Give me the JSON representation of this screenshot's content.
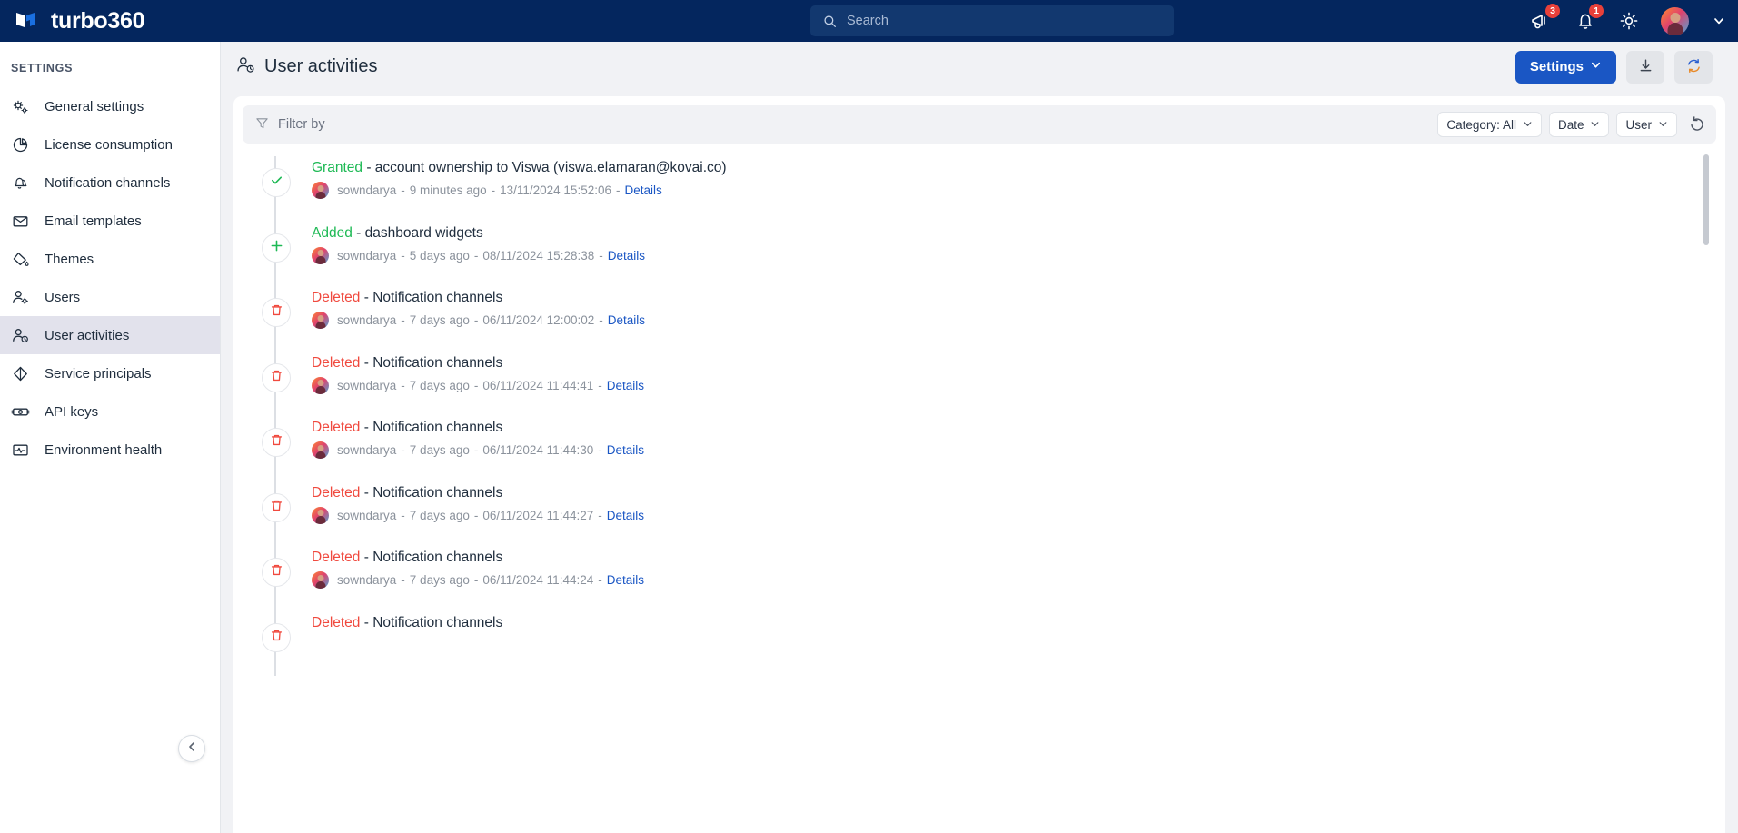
{
  "brand": {
    "name": "turbo360",
    "logo_icon": "turbo360-logo"
  },
  "search": {
    "placeholder": "Search",
    "icon": "search-icon"
  },
  "topbar": {
    "announcements": {
      "icon": "megaphone-icon",
      "badge": "3"
    },
    "notifications": {
      "icon": "bell-icon",
      "badge": "1"
    },
    "settings": {
      "icon": "gear-icon"
    },
    "account": {
      "icon": "user-avatar",
      "chevron": "chevron-down-icon"
    }
  },
  "sidebar": {
    "title": "SETTINGS",
    "collapse_icon": "chevron-left-icon",
    "items": [
      {
        "label": "General settings",
        "icon": "gears-icon",
        "active": false
      },
      {
        "label": "License consumption",
        "icon": "pie-chart-icon",
        "active": false
      },
      {
        "label": "Notification channels",
        "icon": "bells-icon",
        "active": false
      },
      {
        "label": "Email templates",
        "icon": "envelope-icon",
        "active": false
      },
      {
        "label": "Themes",
        "icon": "paint-bucket-icon",
        "active": false
      },
      {
        "label": "Users",
        "icon": "user-gear-icon",
        "active": false
      },
      {
        "label": "User activities",
        "icon": "user-clock-icon",
        "active": true
      },
      {
        "label": "Service principals",
        "icon": "diamond-icon",
        "active": false
      },
      {
        "label": "API keys",
        "icon": "key-card-icon",
        "active": false
      },
      {
        "label": "Environment health",
        "icon": "pulse-monitor-icon",
        "active": false
      }
    ]
  },
  "page": {
    "title": "User activities",
    "title_icon": "user-clock-icon",
    "settings_button": "Settings",
    "settings_chevron": "chevron-down-icon",
    "download_icon": "download-icon",
    "refresh_icon": "refresh-icon"
  },
  "filters": {
    "filter_by_label": "Filter by",
    "filter_icon": "funnel-icon",
    "category": {
      "label": "Category: All",
      "chevron": "chevron-down-icon"
    },
    "date": {
      "label": "Date",
      "chevron": "chevron-down-icon"
    },
    "user": {
      "label": "User",
      "chevron": "chevron-down-icon"
    },
    "reset_icon": "reset-icon"
  },
  "activities": [
    {
      "verb": "Granted",
      "verb_color": "green",
      "marker_icon": "check-icon",
      "description": "- account ownership to Viswa (viswa.elamaran@kovai.co)",
      "user": "sowndarya",
      "relative_time": "9 minutes ago",
      "timestamp": "13/11/2024 15:52:06",
      "details_label": "Details"
    },
    {
      "verb": "Added",
      "verb_color": "green",
      "marker_icon": "plus-icon",
      "description": "- dashboard widgets",
      "user": "sowndarya",
      "relative_time": "5 days ago",
      "timestamp": "08/11/2024 15:28:38",
      "details_label": "Details"
    },
    {
      "verb": "Deleted",
      "verb_color": "red",
      "marker_icon": "trash-icon",
      "description": "- Notification channels",
      "user": "sowndarya",
      "relative_time": "7 days ago",
      "timestamp": "06/11/2024 12:00:02",
      "details_label": "Details"
    },
    {
      "verb": "Deleted",
      "verb_color": "red",
      "marker_icon": "trash-icon",
      "description": "- Notification channels",
      "user": "sowndarya",
      "relative_time": "7 days ago",
      "timestamp": "06/11/2024 11:44:41",
      "details_label": "Details"
    },
    {
      "verb": "Deleted",
      "verb_color": "red",
      "marker_icon": "trash-icon",
      "description": "- Notification channels",
      "user": "sowndarya",
      "relative_time": "7 days ago",
      "timestamp": "06/11/2024 11:44:30",
      "details_label": "Details"
    },
    {
      "verb": "Deleted",
      "verb_color": "red",
      "marker_icon": "trash-icon",
      "description": "- Notification channels",
      "user": "sowndarya",
      "relative_time": "7 days ago",
      "timestamp": "06/11/2024 11:44:27",
      "details_label": "Details"
    },
    {
      "verb": "Deleted",
      "verb_color": "red",
      "marker_icon": "trash-icon",
      "description": "- Notification channels",
      "user": "sowndarya",
      "relative_time": "7 days ago",
      "timestamp": "06/11/2024 11:44:24",
      "details_label": "Details"
    },
    {
      "verb": "Deleted",
      "verb_color": "red",
      "marker_icon": "trash-icon",
      "description": "- Notification channels",
      "user": "",
      "relative_time": "",
      "timestamp": "",
      "details_label": ""
    }
  ],
  "colors": {
    "navy": "#04265e",
    "accent_blue": "#1a56c4",
    "green": "#1db954",
    "red": "#f0493e",
    "badge_red": "#e8403a"
  }
}
